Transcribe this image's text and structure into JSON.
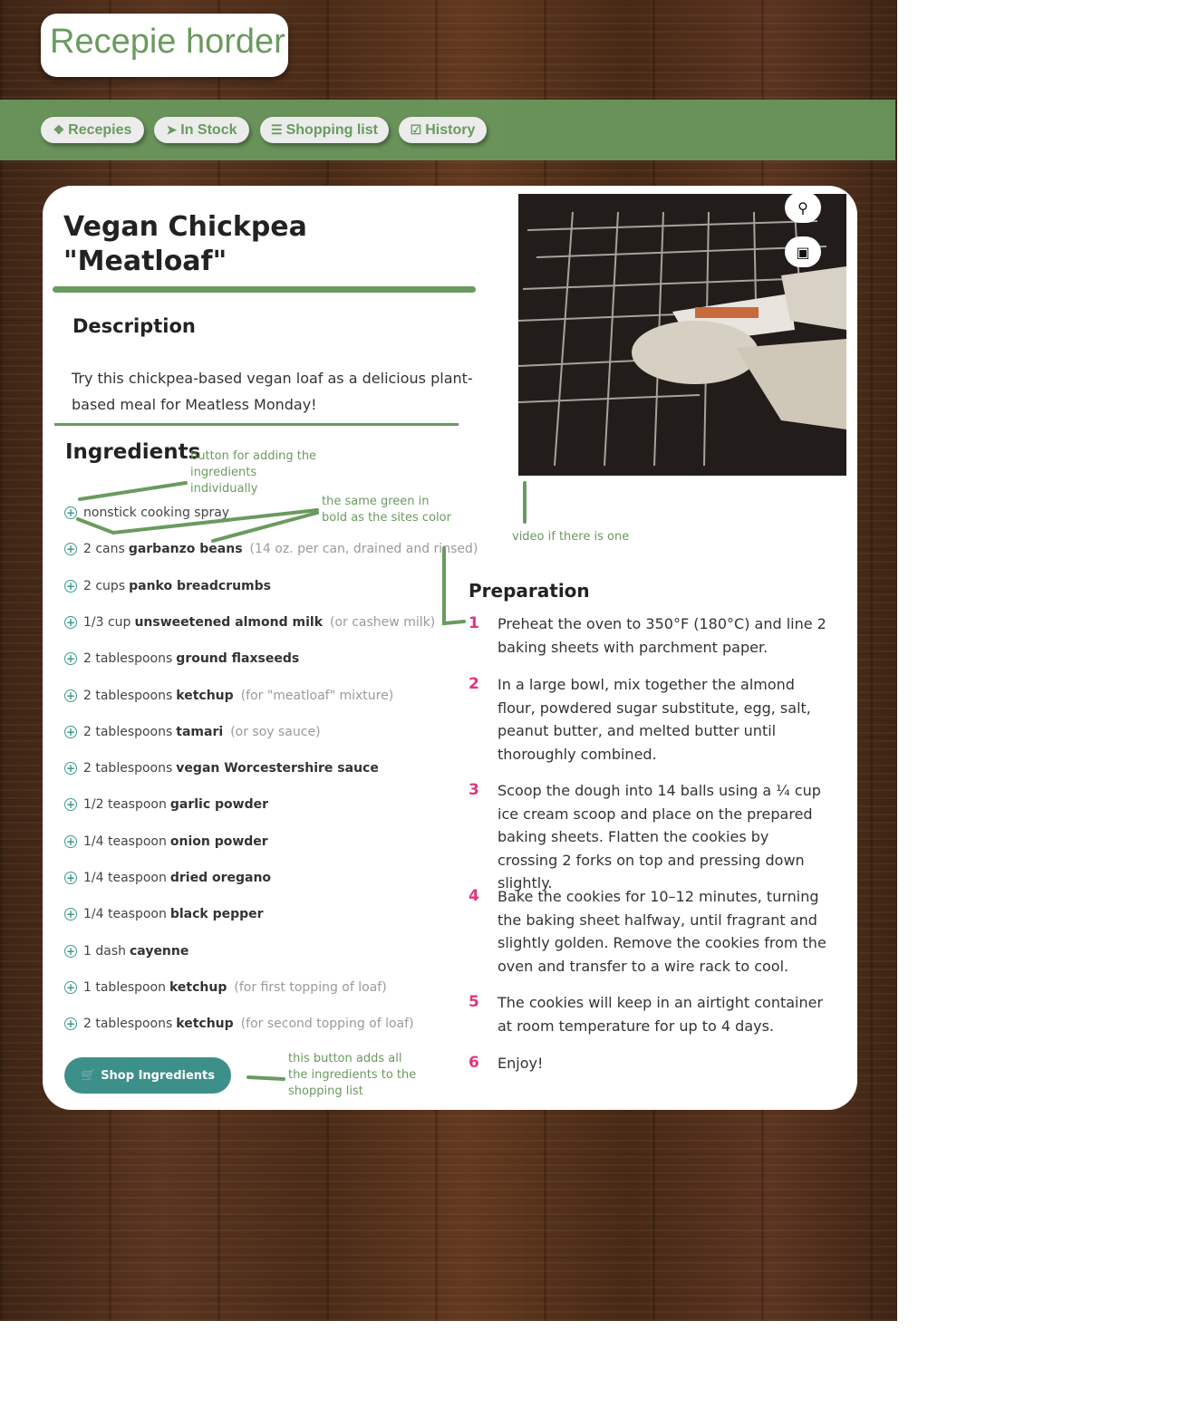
{
  "app": {
    "title": "Recepie horder"
  },
  "nav": [
    {
      "label": "Recepies",
      "icon": "leaf-icon"
    },
    {
      "label": "In Stock",
      "icon": "carrot-icon"
    },
    {
      "label": "Shopping list",
      "icon": "list-icon"
    },
    {
      "label": "History",
      "icon": "calendar-check-icon"
    }
  ],
  "recipe": {
    "title": "Vegan Chickpea \"Meatloaf\"",
    "description_heading": "Description",
    "description": "Try this chickpea-based vegan loaf as a delicious plant-based meal for Meatless Monday!",
    "ingredients_heading": "Ingredients",
    "ingredients": [
      {
        "qty": "",
        "name": "",
        "plain": "nonstick cooking spray",
        "note": ""
      },
      {
        "qty": "2 cans",
        "name": "garbanzo beans",
        "note": "(14 oz. per can, drained and rinsed)"
      },
      {
        "qty": "2 cups",
        "name": "panko breadcrumbs",
        "note": ""
      },
      {
        "qty": "1/3 cup",
        "name": "unsweetened almond milk",
        "note": "(or cashew milk)"
      },
      {
        "qty": "2 tablespoons",
        "name": "ground flaxseeds",
        "note": ""
      },
      {
        "qty": "2 tablespoons",
        "name": "ketchup",
        "note": "(for \"meatloaf\" mixture)"
      },
      {
        "qty": "2 tablespoons",
        "name": "tamari",
        "note": "(or soy sauce)"
      },
      {
        "qty": "2 tablespoons",
        "name": "vegan Worcestershire sauce",
        "note": ""
      },
      {
        "qty": "1/2 teaspoon",
        "name": "garlic powder",
        "note": ""
      },
      {
        "qty": "1/4 teaspoon",
        "name": "onion powder",
        "note": ""
      },
      {
        "qty": "1/4 teaspoon",
        "name": "dried oregano",
        "note": ""
      },
      {
        "qty": "1/4 teaspoon",
        "name": "black pepper",
        "note": ""
      },
      {
        "qty": "1 dash",
        "name": "cayenne",
        "note": ""
      },
      {
        "qty": "1 tablespoon",
        "name": "ketchup",
        "note": "(for first topping of loaf)"
      },
      {
        "qty": "2 tablespoons",
        "name": "ketchup",
        "note": "(for second topping of loaf)"
      }
    ],
    "shop_button": "Shop Ingredients",
    "preparation_heading": "Preparation",
    "steps": [
      {
        "num": "1",
        "text": "Preheat the oven to 350°F (180°C) and line 2 baking sheets with parchment paper."
      },
      {
        "num": "2",
        "text": "In a large bowl, mix together the almond flour, powdered sugar substitute, egg, salt, peanut butter, and melted butter until thoroughly combined."
      },
      {
        "num": "3",
        "text": "Scoop the dough into 14 balls using a ¼ cup ice cream scoop and place on the prepared baking sheets. Flatten the cookies by crossing 2 forks on top and pressing down slightly."
      },
      {
        "num": "4",
        "text": "Bake the cookies for 10–12 minutes, turning the baking sheet halfway, until fragrant and slightly golden. Remove the cookies from the oven and transfer to a wire rack to cool."
      },
      {
        "num": "5",
        "text": "The cookies will keep in an airtight container at room temperature for up to 4 days."
      },
      {
        "num": "6",
        "text": "Enjoy!"
      }
    ]
  },
  "video": {
    "search_icon": "search-icon",
    "save_icon": "save-icon"
  },
  "annotations": {
    "add_button": "button for adding the ingredients individually",
    "same_green": "the same green in bold as the sites color",
    "video": "video if there is one",
    "shop_button": "this button adds all the ingredients to the shopping list"
  },
  "colors": {
    "accent": "#6a9a5f",
    "teal": "#3d8f8a",
    "step_number": "#e0357e"
  }
}
